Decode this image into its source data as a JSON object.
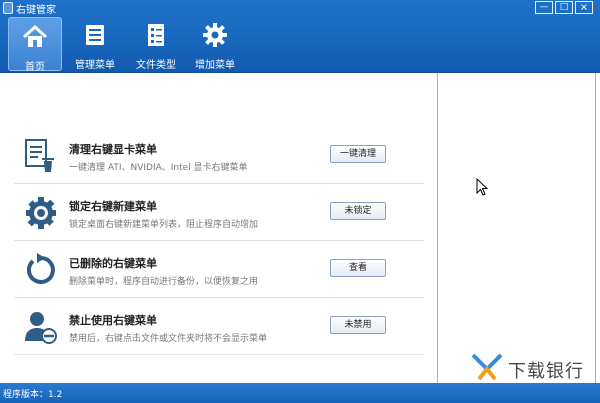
{
  "window": {
    "title": "右键管家",
    "min": "—",
    "max": "□",
    "close": "×"
  },
  "toolbar": {
    "items": [
      {
        "label": "首页",
        "icon": "home-icon",
        "active": true
      },
      {
        "label": "管理菜单",
        "icon": "list-icon"
      },
      {
        "label": "文件类型",
        "icon": "file-list-icon"
      },
      {
        "label": "增加菜单",
        "icon": "gear-icon"
      }
    ]
  },
  "main": {
    "items": [
      {
        "title": "清理右键显卡菜单",
        "desc": "一键清理 ATI、NVIDIA、Intel 显卡右键菜单",
        "button": "一键清理",
        "icon": "clean-list-icon"
      },
      {
        "title": "锁定右键新建菜单",
        "desc": "锁定桌面右键新建菜单列表，阻止程序自动增加",
        "button": "未锁定",
        "icon": "gear-icon"
      },
      {
        "title": "已删除的右键菜单",
        "desc": "删除菜单时，程序自动进行备份，以便恢复之用",
        "button": "查看",
        "icon": "refresh-icon"
      },
      {
        "title": "禁止使用右键菜单",
        "desc": "禁用后，右键点击文件或文件夹时将不会显示菜单",
        "button": "未禁用",
        "icon": "user-block-icon"
      }
    ]
  },
  "statusbar": {
    "version": "程序版本：1.2"
  },
  "watermark": {
    "text": "下载银行"
  },
  "colors": {
    "header": "#1968bf",
    "statusbar": "#1b68c0",
    "icon": "#2f5d86"
  }
}
